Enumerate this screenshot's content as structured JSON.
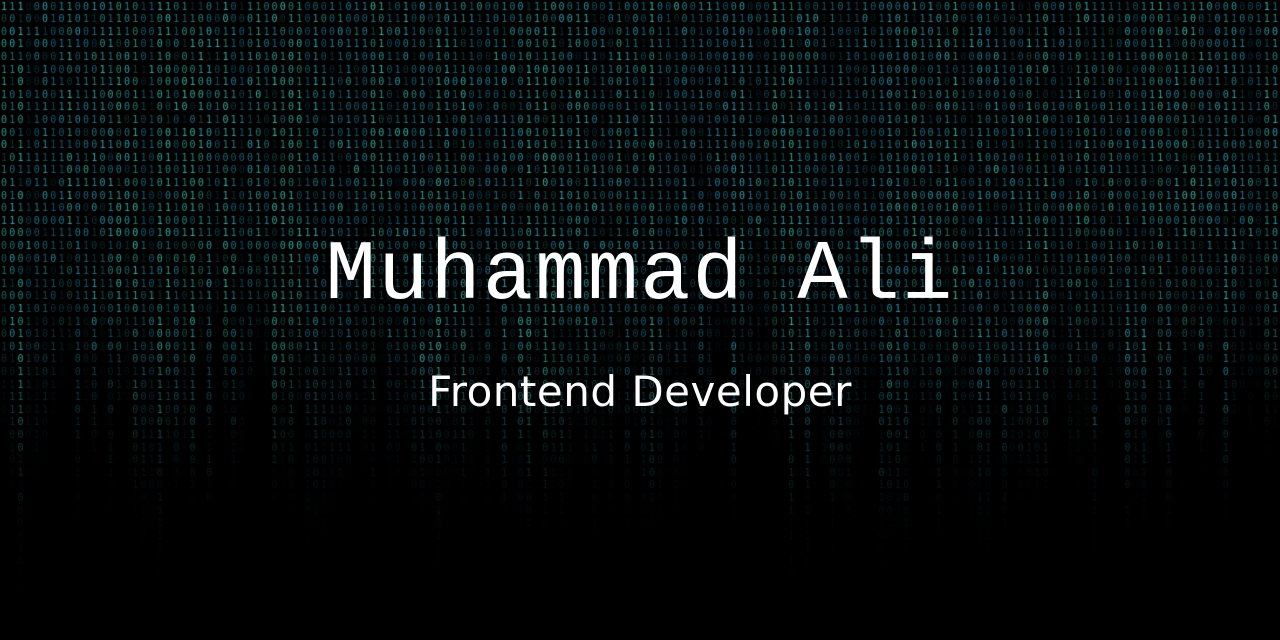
{
  "hero": {
    "name": "Muhammad Ali",
    "role": "Frontend Developer"
  },
  "background": {
    "style": "binary-matrix-rain",
    "glyphs": [
      "0",
      "1"
    ],
    "base_color": "#000000",
    "glyph_colors": [
      "#2b8fb0",
      "#38b3c8",
      "#1f6f8f",
      "#45c9b8"
    ],
    "text_color": "#ffffff"
  }
}
